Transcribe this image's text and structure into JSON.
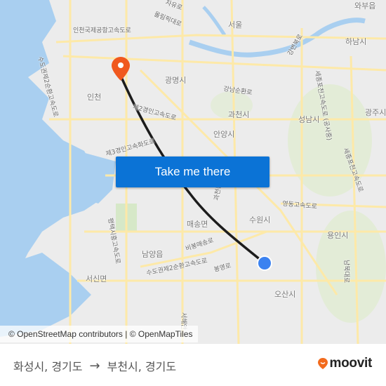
{
  "map": {
    "colors": {
      "water": "#a9cff0",
      "land": "#ececec",
      "park": "#d6e8c8",
      "road": "#fde9a8",
      "route": "#1c1c1c",
      "origin_marker": "#3b82f0",
      "destination_marker": "#f0581e"
    },
    "city_labels": [
      "서울",
      "와부읍",
      "하남시",
      "광주시",
      "성남시",
      "과천시",
      "안양시",
      "광명시",
      "인천",
      "수원시",
      "용인시",
      "오산시",
      "남양읍",
      "서신면",
      "매송면"
    ],
    "road_labels": [
      "인천국제공항고속도로",
      "수도권제2순환고속도로",
      "자유로",
      "올림픽대로",
      "강변북로",
      "세종포천고속도로 (공사중)",
      "강남순환로",
      "제2경인고속도로",
      "제3경인고속화도로",
      "영동고속도로",
      "세종포천고속도로",
      "과천봉담",
      "비봉매송로",
      "수도권제2순환고속도로",
      "봉영로",
      "평택시흥고속도로",
      "남북대로",
      "서해안"
    ],
    "attribution": "© OpenStreetMap contributors | © OpenMapTiles",
    "origin_label": "화성시, 경기도",
    "destination_label": "부천시, 경기도"
  },
  "cta": {
    "label": "Take me there"
  },
  "footer": {
    "origin": "화성시, 경기도",
    "arrow": "→",
    "destination": "부천시, 경기도",
    "brand": "moovit",
    "brand_color": "#f26b1d"
  }
}
